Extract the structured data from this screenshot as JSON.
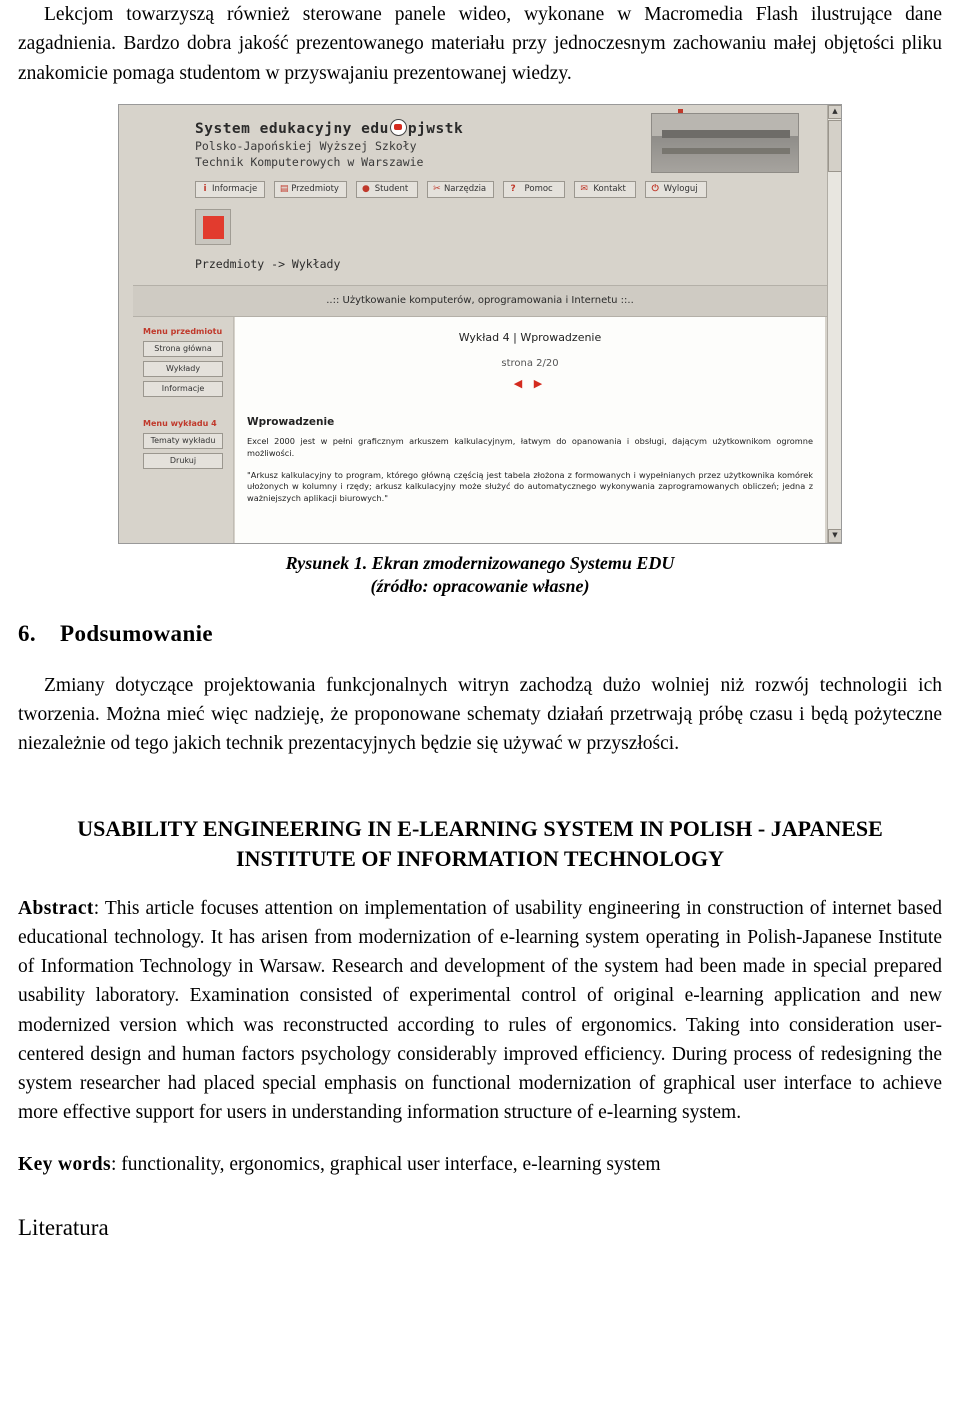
{
  "doc": {
    "para1": "Lekcjom towarzyszą również sterowane panele wideo, wykonane w Macromedia Flash ilustrujące dane zagadnienia. Bardzo dobra jakość prezentowanego materiału przy jednoczesnym zachowaniu małej objętości pliku znakomicie pomaga studentom w przyswajaniu prezentowanej wiedzy.",
    "caption_line1": "Rysunek 1. Ekran zmodernizowanego Systemu EDU",
    "caption_line2": "(źródło: opracowanie własne)",
    "section_number": "6.",
    "section_title": "Podsumowanie",
    "para2": "Zmiany dotyczące projektowania funkcjonalnych witryn zachodzą dużo wolniej niż rozwój technologii ich tworzenia. Można mieć więc nadzieję, że proponowane schematy działań przetrwają próbę czasu i będą pożyteczne niezależnie od tego jakich technik prezentacyjnych będzie się używać w przyszłości.",
    "english_title_line1": "USABILITY ENGINEERING IN E-LEARNING SYSTEM IN POLISH - JAPANESE",
    "english_title_line2": "INSTITUTE OF INFORMATION TECHNOLOGY",
    "abstract_label": "Abstract",
    "abstract_text": ": This article focuses attention on implementation of usability engineering in construction of internet based educational technology. It has arisen from modernization of e-learning system operating in Polish-Japanese Institute of Information Technology in Warsaw. Research and development of the system had been made in special prepared usability laboratory. Examination consisted of experimental control of original e-learning application and new modernized version which was reconstructed according to rules of ergonomics. Taking into consideration user-centered design and human factors psychology considerably improved efficiency. During process of redesigning the system researcher had placed special emphasis on functional modernization of graphical user interface to achieve more effective support for users in understanding information structure of e-learning system.",
    "keywords_label": "Key words",
    "keywords_text": ": functionality, ergonomics, graphical user interface, e-learning system",
    "literatura_heading": "Literatura"
  },
  "screenshot": {
    "system_title_left": "System edukacyjny edu",
    "system_title_right": "pjwstk",
    "subtitle1": "Polsko-Japońskiej Wyższej Szkoły",
    "subtitle2": "Technik Komputerowych w Warszawie",
    "nav": [
      {
        "label": "Informacje",
        "icon": "info-icon",
        "glyph": "i"
      },
      {
        "label": "Przedmioty",
        "icon": "book-icon",
        "glyph": "▤"
      },
      {
        "label": "Student",
        "icon": "user-icon",
        "glyph": "●"
      },
      {
        "label": "Narzędzia",
        "icon": "tools-icon",
        "glyph": "✂"
      },
      {
        "label": "Pomoc",
        "icon": "help-icon",
        "glyph": "?"
      },
      {
        "label": "Kontakt",
        "icon": "mail-icon",
        "glyph": "✉"
      },
      {
        "label": "Wyloguj",
        "icon": "power-icon",
        "glyph": "⏻"
      }
    ],
    "breadcrumb": "Przedmioty -> Wykłady",
    "banner": "..:: Użytkowanie komputerów, oprogramowania i Internetu ::..",
    "left_menu_title": "Menu przedmiotu",
    "left_menu_items": [
      "Strona główna",
      "Wykłady",
      "Informacje"
    ],
    "left_menu2_title": "Menu wykładu 4",
    "left_menu2_items": [
      "Tematy wykładu",
      "Drukuj"
    ],
    "lecture_title": "Wykład 4 | Wprowadzenie",
    "page_indicator": "strona 2/20",
    "nav_arrows": "◀ ▶",
    "content_heading": "Wprowadzenie",
    "content_para1": "Excel 2000 jest w pełni graficznym arkuszem kalkulacyjnym, łatwym do opanowania i obsługi, dającym użytkownikom ogromne możliwości.",
    "content_para2": "\"Arkusz kalkulacyjny to program, którego główną częścią jest tabela złożona z formowanych i wypełnianych przez użytkownika komórek ułożonych w kolumny i rzędy; arkusz kalkulacyjny może służyć do automatycznego wykonywania zaprogramowanych obliczeń; jedna z ważniejszych aplikacji biurowych.\"",
    "scroll_up": "▲",
    "scroll_down": "▼"
  }
}
